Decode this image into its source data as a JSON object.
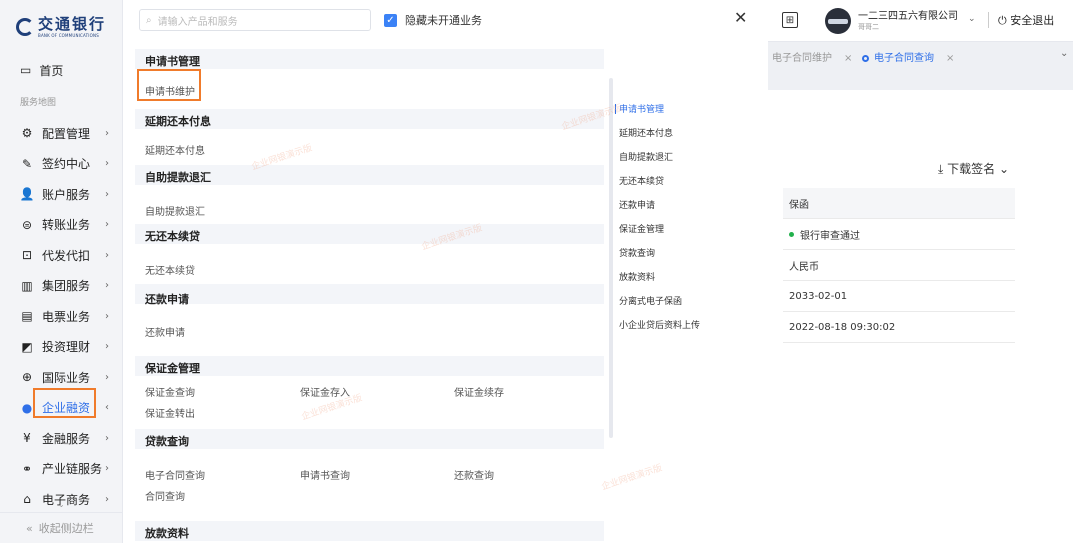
{
  "logo": {
    "cn": "交通银行",
    "en": "BANK OF COMMUNICATIONS"
  },
  "sidebar": {
    "home": "首页",
    "section": "服务地图",
    "items": [
      {
        "label": "配置管理",
        "icon": "settings-icon",
        "glyph": "⚙"
      },
      {
        "label": "签约中心",
        "icon": "pen-icon",
        "glyph": "✎"
      },
      {
        "label": "账户服务",
        "icon": "user-icon",
        "glyph": "👤"
      },
      {
        "label": "转账业务",
        "icon": "transfer-icon",
        "glyph": "⊜"
      },
      {
        "label": "代发代扣",
        "icon": "payroll-icon",
        "glyph": "⊡"
      },
      {
        "label": "集团服务",
        "icon": "building-icon",
        "glyph": "▥"
      },
      {
        "label": "电票业务",
        "icon": "bill-icon",
        "glyph": "▤"
      },
      {
        "label": "投资理财",
        "icon": "chart-icon",
        "glyph": "◩"
      },
      {
        "label": "国际业务",
        "icon": "globe-icon",
        "glyph": "⊕"
      },
      {
        "label": "企业融资",
        "icon": "finance-icon",
        "glyph": "●"
      },
      {
        "label": "金融服务",
        "icon": "coin-icon",
        "glyph": "¥"
      },
      {
        "label": "产业链服务",
        "icon": "network-icon",
        "glyph": "⚭"
      },
      {
        "label": "电子商务",
        "icon": "shop-icon",
        "glyph": "⌂"
      }
    ],
    "collapse": "收起侧边栏"
  },
  "search": {
    "placeholder": "请输入产品和服务"
  },
  "toggle": {
    "label": "隐藏未开通业务"
  },
  "menu": {
    "groups": [
      {
        "title": "申请书管理",
        "items": [
          "申请书维护"
        ]
      },
      {
        "title": "延期还本付息",
        "items": [
          "延期还本付息"
        ]
      },
      {
        "title": "自助提款退汇",
        "items": [
          "自助提款退汇"
        ]
      },
      {
        "title": "无还本续贷",
        "items": [
          "无还本续贷"
        ]
      },
      {
        "title": "还款申请",
        "items": [
          "还款申请"
        ]
      },
      {
        "title": "保证金管理",
        "items": [
          "保证金查询",
          "保证金存入",
          "保证金续存",
          "保证金转出"
        ]
      },
      {
        "title": "贷款查询",
        "items": [
          "电子合同查询",
          "申请书查询",
          "还款查询",
          "合同查询"
        ]
      },
      {
        "title": "放款资料",
        "items": []
      }
    ],
    "right_nav": [
      "申请书管理",
      "延期还本付息",
      "自助提款退汇",
      "无还本续贷",
      "还款申请",
      "保证金管理",
      "贷款查询",
      "放款资料",
      "分离式电子保函",
      "小企业贷后资料上传"
    ]
  },
  "bg": {
    "company": "一二三四五六有限公司",
    "company_sub": "哥哥二",
    "logout": "安全退出",
    "tabs": [
      "电子合同维护",
      "电子合同查询"
    ],
    "download": "下载签名",
    "rows": [
      "保函",
      "银行审查通过",
      "人民币",
      "2033-02-01",
      "2022-08-18 09:30:02"
    ]
  },
  "watermark": "企业网银演示版",
  "colors": {
    "accent": "#2f6fe8",
    "highlight": "#f07b2b",
    "brand": "#1f3f7a"
  }
}
